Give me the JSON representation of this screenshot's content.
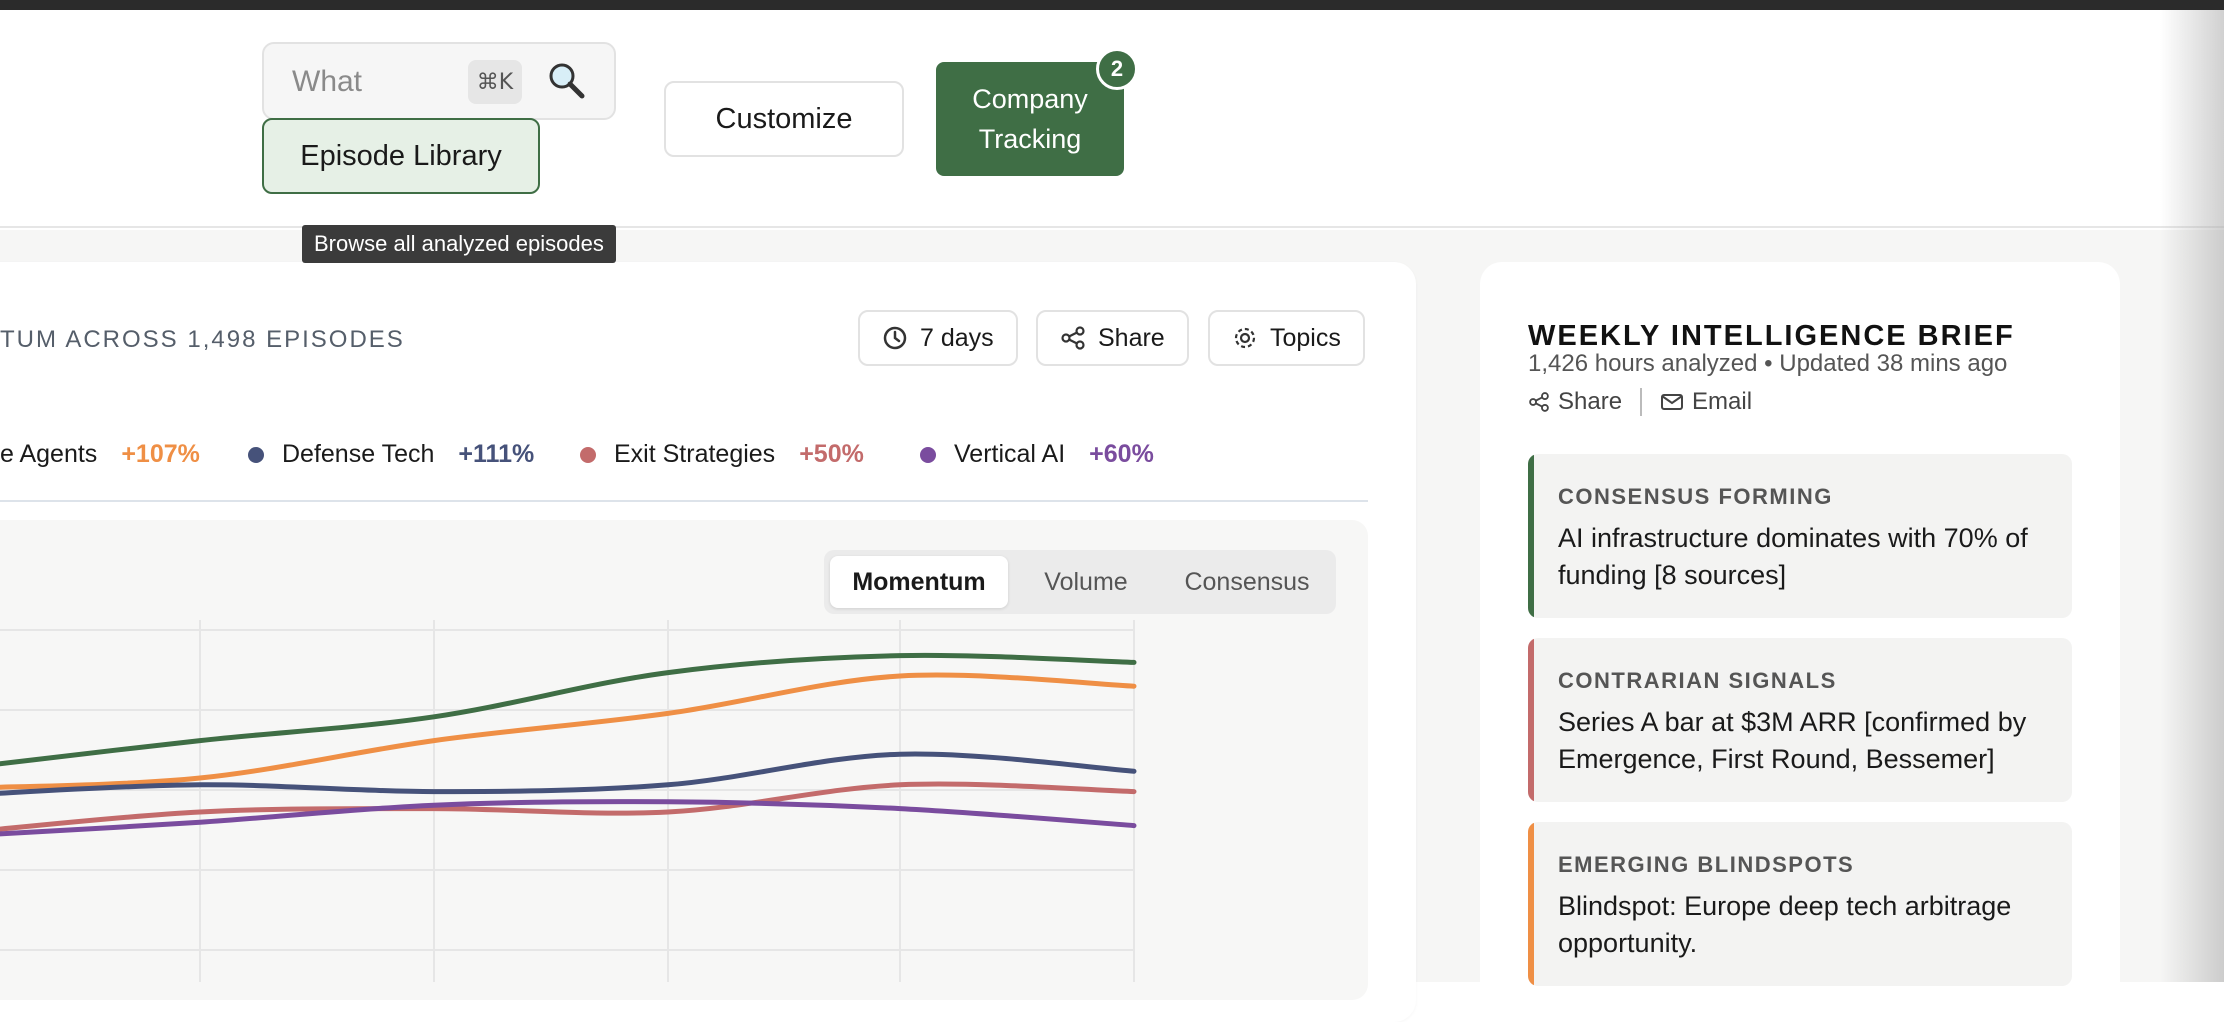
{
  "header": {
    "search": {
      "placeholder": "What",
      "shortcut": "⌘K"
    },
    "episode_library_label": "Episode Library",
    "tooltip": "Browse all analyzed episodes",
    "customize_label": "Customize",
    "tracking_label_line1": "Company",
    "tracking_label_line2": "Tracking",
    "tracking_badge": "2"
  },
  "momentum": {
    "title": "TUM ACROSS 1,498 EPISODES",
    "controls": {
      "days_label": "7 days",
      "share_label": "Share",
      "topics_label": "Topics"
    },
    "legend": [
      {
        "name": "e Agents",
        "delta": "+107%",
        "color": "#ef8f45"
      },
      {
        "name": "Defense Tech",
        "delta": "+111%",
        "color": "#46527a"
      },
      {
        "name": "Exit Strategies",
        "delta": "+50%",
        "color": "#c36b6b"
      },
      {
        "name": "Vertical AI",
        "delta": "+60%",
        "color": "#7a4c9e"
      }
    ],
    "tabs": [
      {
        "label": "Momentum",
        "active": true
      },
      {
        "label": "Volume",
        "active": false
      },
      {
        "label": "Consensus",
        "active": false
      }
    ]
  },
  "chart_data": {
    "type": "line",
    "x": [
      0,
      1,
      2,
      3,
      4,
      5
    ],
    "series": [
      {
        "color": "#3f6e45",
        "values": [
          0.63,
          0.71,
          0.78,
          0.91,
          0.96,
          0.94
        ]
      },
      {
        "name": "e Agents",
        "color": "#ef8f45",
        "values": [
          0.57,
          0.6,
          0.71,
          0.79,
          0.9,
          0.87
        ]
      },
      {
        "name": "Defense Tech",
        "color": "#46527a",
        "values": [
          0.55,
          0.58,
          0.56,
          0.58,
          0.67,
          0.62
        ]
      },
      {
        "name": "Exit Strategies",
        "color": "#c36b6b",
        "values": [
          0.44,
          0.5,
          0.51,
          0.5,
          0.58,
          0.56
        ]
      },
      {
        "name": "Vertical AI",
        "color": "#7a4c9e",
        "values": [
          0.43,
          0.47,
          0.52,
          0.53,
          0.51,
          0.46
        ]
      }
    ],
    "grid": true
  },
  "brief": {
    "title": "WEEKLY INTELLIGENCE BRIEF",
    "meta": "1,426 hours analyzed • Updated 38 mins ago",
    "share_label": "Share",
    "email_label": "Email",
    "items": [
      {
        "label": "CONSENSUS FORMING",
        "text": "AI infrastructure dominates with 70% of funding [8 sources]",
        "color": "#3f6e45"
      },
      {
        "label": "CONTRARIAN SIGNALS",
        "text": "Series A bar at $3M ARR [confirmed by Emergence, First Round, Bessemer]",
        "color": "#c36b6b"
      },
      {
        "label": "EMERGING BLINDSPOTS",
        "text": "Blindspot: Europe deep tech arbitrage opportunity.",
        "color": "#ef8f45"
      }
    ]
  }
}
